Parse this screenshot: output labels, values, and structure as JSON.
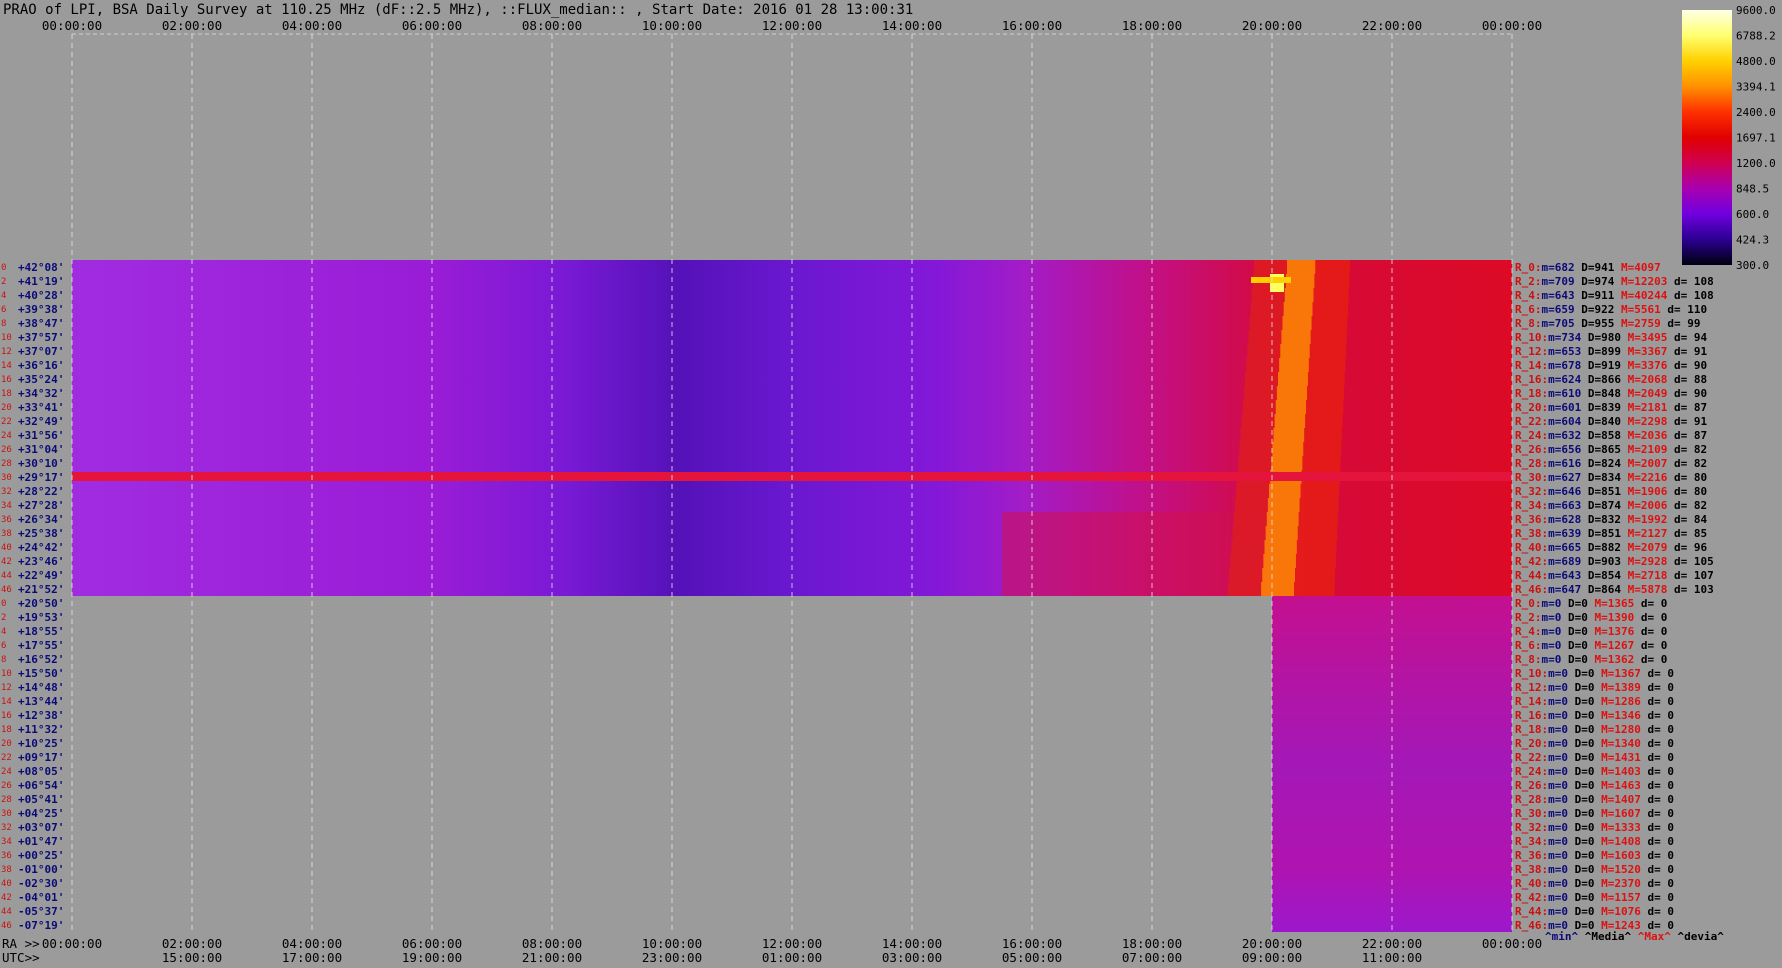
{
  "title": "PRAO of LPI, BSA Daily Survey at 110.25 MHz (dF::2.5 MHz), ::FLUX_median:: , Start Date: 2016 01 28 13:00:31",
  "colors": {
    "background": "#9b9b9b",
    "dec_label": "#0b0b78",
    "row_index": "#cc1111",
    "stat_label": "#cc1111",
    "stat_min": "#0b0b78",
    "stat_median": "#000000",
    "stat_max": "#dd1111",
    "stat_dev": "#000000"
  },
  "chart_data": {
    "type": "heatmap",
    "ra_ticks": [
      "00:00:00",
      "02:00:00",
      "04:00:00",
      "06:00:00",
      "08:00:00",
      "10:00:00",
      "12:00:00",
      "14:00:00",
      "16:00:00",
      "18:00:00",
      "20:00:00",
      "22:00:00",
      "00:00:00"
    ],
    "utc_ticks": [
      "15:00:00",
      "17:00:00",
      "19:00:00",
      "21:00:00",
      "23:00:00",
      "01:00:00",
      "03:00:00",
      "05:00:00",
      "07:00:00",
      "09:00:00",
      "11:00:00"
    ],
    "ra_label": "RA >>",
    "utc_label": "UTC>>",
    "declinations": [
      "+42°08'",
      "+41°19'",
      "+40°28'",
      "+39°38'",
      "+38°47'",
      "+37°57'",
      "+37°07'",
      "+36°16'",
      "+35°24'",
      "+34°32'",
      "+33°41'",
      "+32°49'",
      "+31°56'",
      "+31°04'",
      "+30°10'",
      "+29°17'",
      "+28°22'",
      "+27°28'",
      "+26°34'",
      "+25°38'",
      "+24°42'",
      "+23°46'",
      "+22°49'",
      "+21°52'",
      "+20°50'",
      "+19°53'",
      "+18°55'",
      "+17°55'",
      "+16°52'",
      "+15°50'",
      "+14°48'",
      "+13°44'",
      "+12°38'",
      "+11°32'",
      "+10°25'",
      "+09°17'",
      "+08°05'",
      "+06°54'",
      "+05°41'",
      "+04°25'",
      "+03°07'",
      "+01°47'",
      "+00°25'",
      "-01°00'",
      "-02°30'",
      "-04°01'",
      "-05°37'",
      "-07°19'"
    ],
    "row_indices": [
      "0",
      "2",
      "4",
      "6",
      "8",
      "10",
      "12",
      "14",
      "16",
      "18",
      "20",
      "22",
      "24",
      "26",
      "28",
      "30",
      "32",
      "34",
      "36",
      "38",
      "40",
      "42",
      "44",
      "46",
      "0",
      "2",
      "4",
      "6",
      "8",
      "10",
      "12",
      "14",
      "16",
      "18",
      "20",
      "22",
      "24",
      "26",
      "28",
      "30",
      "32",
      "34",
      "36",
      "38",
      "40",
      "42",
      "44",
      "46"
    ],
    "stats": [
      {
        "label": "R_0:",
        "min": "m=682",
        "median": "D=941",
        "max": "M=4097",
        "dev": ""
      },
      {
        "label": "R_2:",
        "min": "m=709",
        "median": "D=974",
        "max": "M=12203",
        "dev": "d= 108"
      },
      {
        "label": "R_4:",
        "min": "m=643",
        "median": "D=911",
        "max": "M=40244",
        "dev": "d= 108"
      },
      {
        "label": "R_6:",
        "min": "m=659",
        "median": "D=922",
        "max": "M=5561",
        "dev": "d= 110"
      },
      {
        "label": "R_8:",
        "min": "m=705",
        "median": "D=955",
        "max": "M=2759",
        "dev": "d= 99"
      },
      {
        "label": "R_10:",
        "min": "m=734",
        "median": "D=980",
        "max": "M=3495",
        "dev": "d= 94"
      },
      {
        "label": "R_12:",
        "min": "m=653",
        "median": "D=899",
        "max": "M=3367",
        "dev": "d= 91"
      },
      {
        "label": "R_14:",
        "min": "m=678",
        "median": "D=919",
        "max": "M=3376",
        "dev": "d= 90"
      },
      {
        "label": "R_16:",
        "min": "m=624",
        "median": "D=866",
        "max": "M=2068",
        "dev": "d= 88"
      },
      {
        "label": "R_18:",
        "min": "m=610",
        "median": "D=848",
        "max": "M=2049",
        "dev": "d= 90"
      },
      {
        "label": "R_20:",
        "min": "m=601",
        "median": "D=839",
        "max": "M=2181",
        "dev": "d= 87"
      },
      {
        "label": "R_22:",
        "min": "m=604",
        "median": "D=840",
        "max": "M=2298",
        "dev": "d= 91"
      },
      {
        "label": "R_24:",
        "min": "m=632",
        "median": "D=858",
        "max": "M=2036",
        "dev": "d= 87"
      },
      {
        "label": "R_26:",
        "min": "m=656",
        "median": "D=865",
        "max": "M=2109",
        "dev": "d= 82"
      },
      {
        "label": "R_28:",
        "min": "m=616",
        "median": "D=824",
        "max": "M=2007",
        "dev": "d= 82"
      },
      {
        "label": "R_30:",
        "min": "m=627",
        "median": "D=834",
        "max": "M=2216",
        "dev": "d= 80"
      },
      {
        "label": "R_32:",
        "min": "m=646",
        "median": "D=851",
        "max": "M=1906",
        "dev": "d= 80"
      },
      {
        "label": "R_34:",
        "min": "m=663",
        "median": "D=874",
        "max": "M=2006",
        "dev": "d= 82"
      },
      {
        "label": "R_36:",
        "min": "m=628",
        "median": "D=832",
        "max": "M=1992",
        "dev": "d= 84"
      },
      {
        "label": "R_38:",
        "min": "m=639",
        "median": "D=851",
        "max": "M=2127",
        "dev": "d= 85"
      },
      {
        "label": "R_40:",
        "min": "m=665",
        "median": "D=882",
        "max": "M=2079",
        "dev": "d= 96"
      },
      {
        "label": "R_42:",
        "min": "m=689",
        "median": "D=903",
        "max": "M=2928",
        "dev": "d= 105"
      },
      {
        "label": "R_44:",
        "min": "m=643",
        "median": "D=854",
        "max": "M=2718",
        "dev": "d= 107"
      },
      {
        "label": "R_46:",
        "min": "m=647",
        "median": "D=864",
        "max": "M=5878",
        "dev": "d= 103"
      },
      {
        "label": "R_0:",
        "min": "m=0",
        "median": "D=0",
        "max": "M=1365",
        "dev": "d= 0"
      },
      {
        "label": "R_2:",
        "min": "m=0",
        "median": "D=0",
        "max": "M=1390",
        "dev": "d= 0"
      },
      {
        "label": "R_4:",
        "min": "m=0",
        "median": "D=0",
        "max": "M=1376",
        "dev": "d= 0"
      },
      {
        "label": "R_6:",
        "min": "m=0",
        "median": "D=0",
        "max": "M=1267",
        "dev": "d= 0"
      },
      {
        "label": "R_8:",
        "min": "m=0",
        "median": "D=0",
        "max": "M=1362",
        "dev": "d= 0"
      },
      {
        "label": "R_10:",
        "min": "m=0",
        "median": "D=0",
        "max": "M=1367",
        "dev": "d= 0"
      },
      {
        "label": "R_12:",
        "min": "m=0",
        "median": "D=0",
        "max": "M=1389",
        "dev": "d= 0"
      },
      {
        "label": "R_14:",
        "min": "m=0",
        "median": "D=0",
        "max": "M=1286",
        "dev": "d= 0"
      },
      {
        "label": "R_16:",
        "min": "m=0",
        "median": "D=0",
        "max": "M=1346",
        "dev": "d= 0"
      },
      {
        "label": "R_18:",
        "min": "m=0",
        "median": "D=0",
        "max": "M=1280",
        "dev": "d= 0"
      },
      {
        "label": "R_20:",
        "min": "m=0",
        "median": "D=0",
        "max": "M=1340",
        "dev": "d= 0"
      },
      {
        "label": "R_22:",
        "min": "m=0",
        "median": "D=0",
        "max": "M=1431",
        "dev": "d= 0"
      },
      {
        "label": "R_24:",
        "min": "m=0",
        "median": "D=0",
        "max": "M=1403",
        "dev": "d= 0"
      },
      {
        "label": "R_26:",
        "min": "m=0",
        "median": "D=0",
        "max": "M=1463",
        "dev": "d= 0"
      },
      {
        "label": "R_28:",
        "min": "m=0",
        "median": "D=0",
        "max": "M=1407",
        "dev": "d= 0"
      },
      {
        "label": "R_30:",
        "min": "m=0",
        "median": "D=0",
        "max": "M=1607",
        "dev": "d= 0"
      },
      {
        "label": "R_32:",
        "min": "m=0",
        "median": "D=0",
        "max": "M=1333",
        "dev": "d= 0"
      },
      {
        "label": "R_34:",
        "min": "m=0",
        "median": "D=0",
        "max": "M=1408",
        "dev": "d= 0"
      },
      {
        "label": "R_36:",
        "min": "m=0",
        "median": "D=0",
        "max": "M=1603",
        "dev": "d= 0"
      },
      {
        "label": "R_38:",
        "min": "m=0",
        "median": "D=0",
        "max": "M=1520",
        "dev": "d= 0"
      },
      {
        "label": "R_40:",
        "min": "m=0",
        "median": "D=0",
        "max": "M=2370",
        "dev": "d= 0"
      },
      {
        "label": "R_42:",
        "min": "m=0",
        "median": "D=0",
        "max": "M=1157",
        "dev": "d= 0"
      },
      {
        "label": "R_44:",
        "min": "m=0",
        "median": "D=0",
        "max": "M=1076",
        "dev": "d= 0"
      },
      {
        "label": "R_46:",
        "min": "m=0",
        "median": "D=0",
        "max": "M=1243",
        "dev": "d= 0"
      }
    ],
    "stats_footer": [
      {
        "text": "^min^",
        "color": "#0b0b78"
      },
      {
        "text": "^Media^",
        "color": "#000000"
      },
      {
        "text": "^Max^",
        "color": "#dd1111"
      },
      {
        "text": "^devia^",
        "color": "#000000"
      }
    ],
    "colorbar": {
      "ticks": [
        "9600.0",
        "6788.2",
        "4800.0",
        "3394.1",
        "2400.0",
        "1697.1",
        "1200.0",
        "848.5",
        "600.0",
        "424.3",
        "300.0"
      ],
      "stops": [
        "#ffffe6",
        "#ffff70",
        "#ffd000",
        "#ff9000",
        "#ff3000",
        "#e00000",
        "#d00050",
        "#a800b0",
        "#7000e0",
        "#2a0090",
        "#000010"
      ]
    },
    "blocks": [
      {
        "rows": [
          0,
          23
        ],
        "ra_start": "00:00:00",
        "ra_end": "24:00:00"
      },
      {
        "rows": [
          24,
          47
        ],
        "ra_start": "20:00:00",
        "ra_end": "24:00:00"
      }
    ],
    "features": [
      {
        "name": "bright-horizontal-row",
        "row": 15,
        "color": "#e4143c"
      },
      {
        "name": "solar-emission-track",
        "ra_start": "20:00:00",
        "ra_end": "21:30:00",
        "color": "#ff9000"
      }
    ]
  }
}
